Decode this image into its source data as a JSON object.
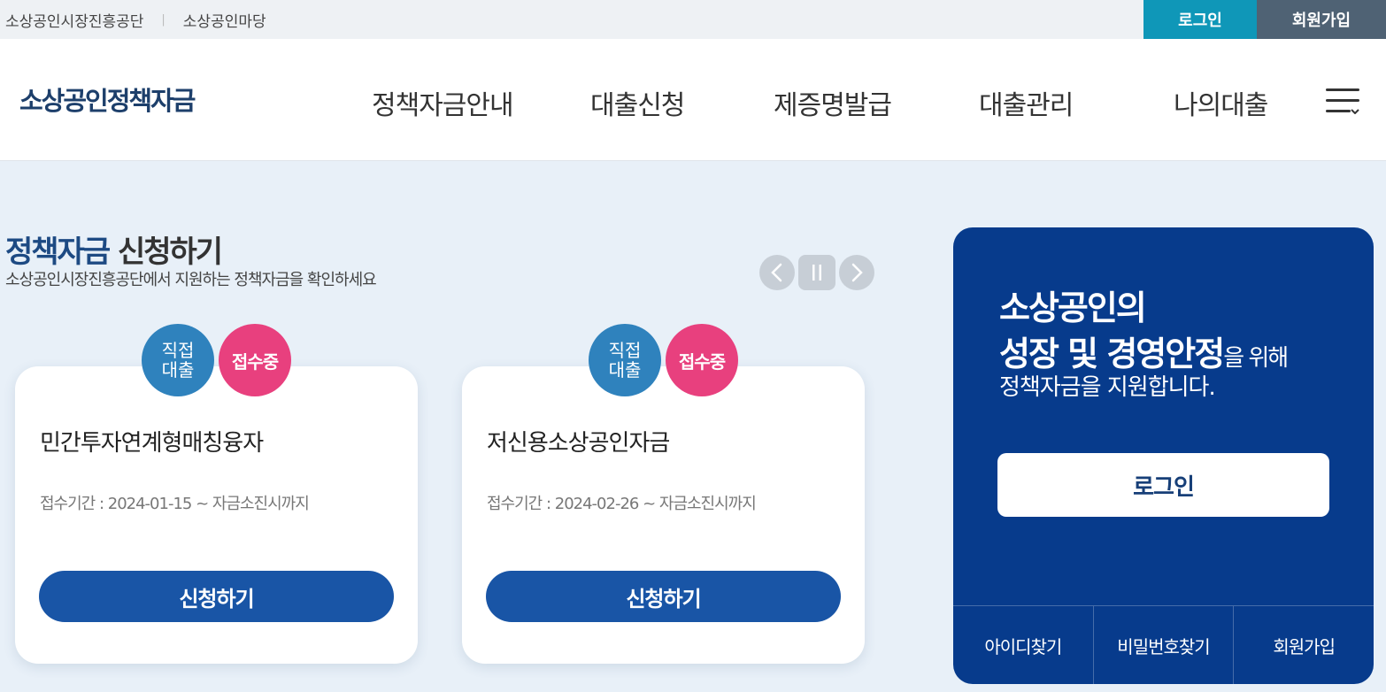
{
  "topbar": {
    "links": [
      "소상공인시장진흥공단",
      "소상공인마당"
    ],
    "separator": "|",
    "login_label": "로그인",
    "join_label": "회원가입"
  },
  "header": {
    "logo": "소상공인정책자금",
    "nav": [
      "정책자금안내",
      "대출신청",
      "제증명발급",
      "대출관리",
      "나의대출"
    ],
    "menu_icon": "hamburger-menu-icon"
  },
  "section": {
    "title_highlight": "정책자금",
    "title_rest": " 신청하기",
    "subtitle": "소상공인시장진흥공단에서 지원하는 정책자금을 확인하세요",
    "controls": [
      "chevron-left-icon",
      "pause-icon",
      "chevron-right-icon"
    ]
  },
  "cards": [
    {
      "badge_type_line1": "직접",
      "badge_type_line2": "대출",
      "badge_status": "접수중",
      "title": "민간투자연계형매칭융자",
      "period": "접수기간 : 2024-01-15 ~ 자금소진시까지",
      "button": "신청하기"
    },
    {
      "badge_type_line1": "직접",
      "badge_type_line2": "대출",
      "badge_status": "접수중",
      "title": "저신용소상공인자금",
      "period": "접수기간 : 2024-02-26 ~ 자금소진시까지",
      "button": "신청하기"
    }
  ],
  "login_panel": {
    "line1": "소상공인의",
    "line2_strong": "성장 및 경영안정",
    "line2_weak": "을 위해",
    "line3": "정책자금을 지원합니다.",
    "login_button": "로그인",
    "links": [
      "아이디찾기",
      "비밀번호찾기",
      "회원가입"
    ]
  },
  "colors": {
    "login_top": "#0f97b8",
    "join_top": "#4f6274",
    "primary": "#1955a6",
    "panel": "#073b8c",
    "badge_type": "#2f82bd",
    "badge_status": "#e8407e"
  }
}
